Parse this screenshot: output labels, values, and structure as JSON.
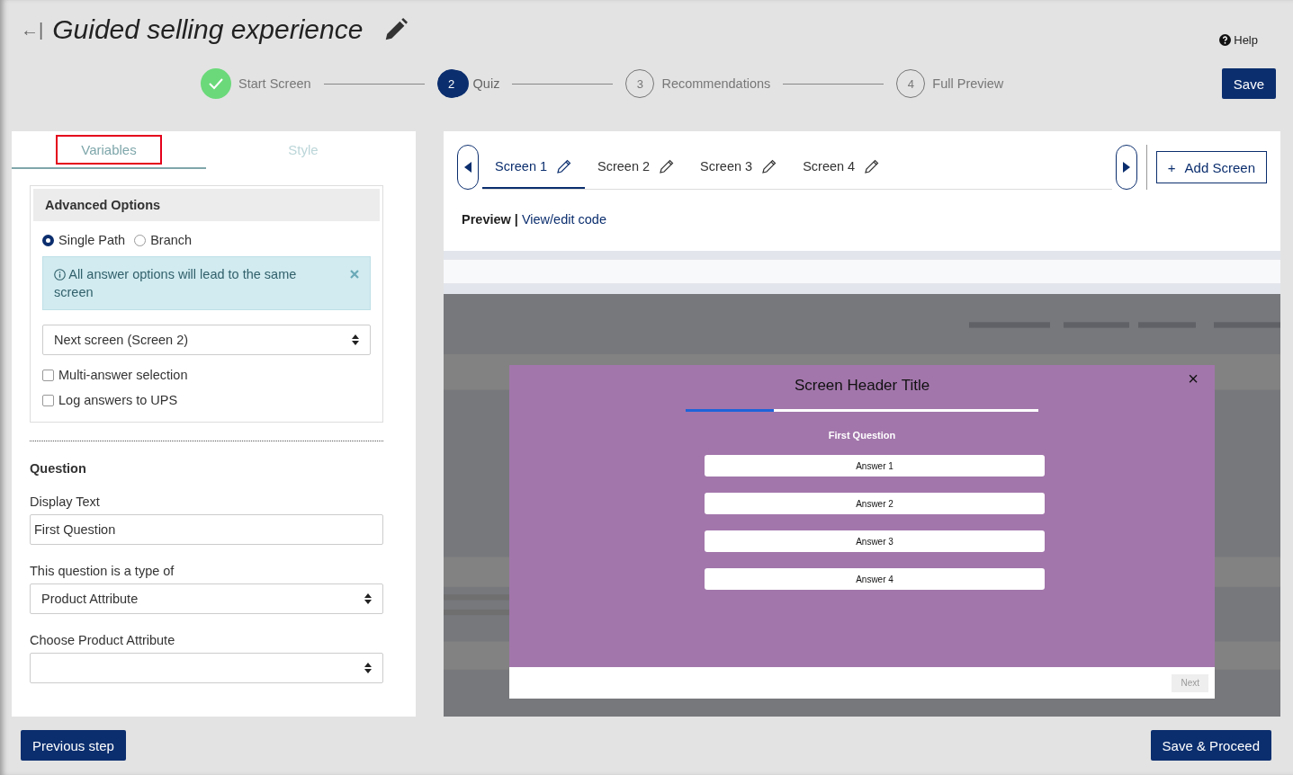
{
  "header": {
    "back": "←|",
    "title": "Guided selling experience",
    "help": "Help"
  },
  "steps": [
    {
      "completed": true,
      "current": false,
      "label": "Start Screen"
    },
    {
      "completed": false,
      "current": true,
      "number": "2",
      "label": "Quiz"
    },
    {
      "completed": false,
      "current": false,
      "number": "3",
      "label": "Recommendations"
    },
    {
      "completed": false,
      "current": false,
      "number": "4",
      "label": "Full Preview"
    }
  ],
  "save_button": "Save",
  "left_panel": {
    "tabs": [
      {
        "label": "Variables",
        "selected": true
      },
      {
        "label": "Style",
        "selected": false
      }
    ],
    "advanced_options": {
      "title": "Advanced Options",
      "path_options": [
        {
          "label": "Single Path",
          "selected": true
        },
        {
          "label": "Branch",
          "selected": false
        }
      ],
      "info": "All answer options will lead to the same screen",
      "next_screen": "Next screen (Screen 2)",
      "checkboxes": [
        {
          "label": "Multi-answer selection",
          "checked": false
        },
        {
          "label": "Log answers to UPS",
          "checked": false
        }
      ]
    },
    "question": {
      "title": "Question",
      "display_text_label": "Display Text",
      "display_text": "First Question",
      "type_label": "This question is a type of",
      "type_value": "Product Attribute",
      "attribute_label": "Choose Product Attribute"
    }
  },
  "screen_tabs": [
    {
      "label": "Screen 1",
      "selected": true
    },
    {
      "label": "Screen 2",
      "selected": false
    },
    {
      "label": "Screen 3",
      "selected": false
    },
    {
      "label": "Screen 4",
      "selected": false
    }
  ],
  "add_screen": {
    "icon": "+",
    "label": "Add Screen"
  },
  "preview_links": {
    "preview": "Preview |",
    "edit": "View/edit code"
  },
  "modal": {
    "title": "Screen Header Title",
    "close": "×",
    "progress": {
      "level": 0.25
    },
    "question": "First Question",
    "answers": [
      "Answer 1",
      "Answer 2",
      "Answer 3",
      "Answer 4"
    ],
    "next": "Next"
  },
  "footer": {
    "previous": "Previous step",
    "proceed": "Save & Proceed"
  }
}
